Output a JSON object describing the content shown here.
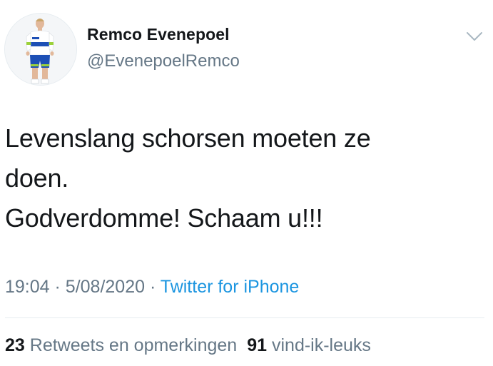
{
  "author": {
    "name": "Remco Evenepoel",
    "handle": "@EvenepoelRemco"
  },
  "tweet": {
    "lines": [
      "Levenslang schorsen moeten ze",
      "doen.",
      "Godverdomme! Schaam u!!!"
    ]
  },
  "meta": {
    "time": "19:04",
    "separator": "·",
    "date": "5/08/2020",
    "source": "Twitter for iPhone"
  },
  "stats": {
    "retweets_count": "23",
    "retweets_label": "Retweets en opmerkingen",
    "likes_count": "91",
    "likes_label": "vind-ik-leuks"
  },
  "icons": {
    "menu": "chevron-down-icon",
    "avatar": "avatar"
  },
  "colors": {
    "text_primary": "#14171a",
    "text_secondary": "#657786",
    "link": "#1b95e0",
    "divider": "#e6ecf0"
  }
}
